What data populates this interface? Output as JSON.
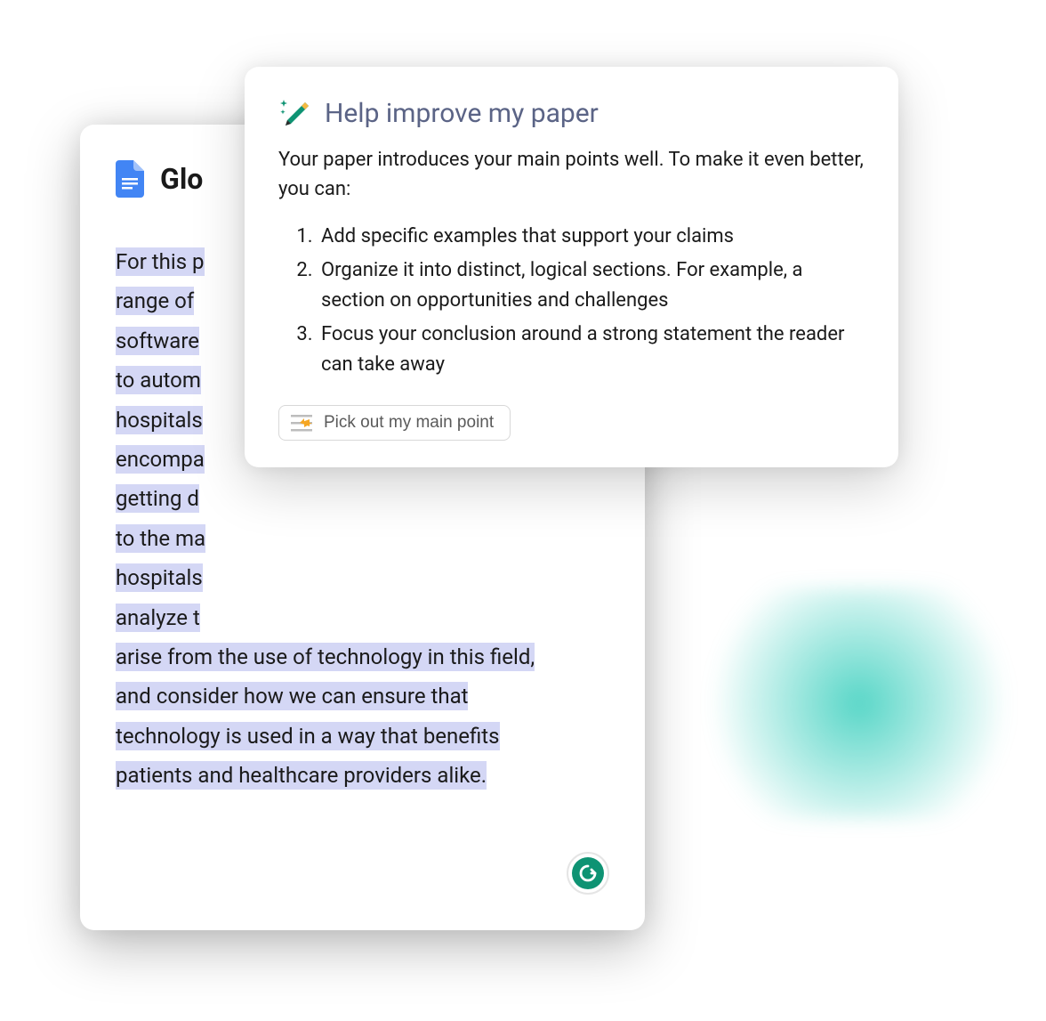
{
  "document": {
    "title_prefix": "Glo",
    "body_lines": [
      "For this p",
      "range of ",
      "software ",
      "to autom",
      "hospitals",
      "encompa",
      "getting d",
      "to the ma",
      "hospitals",
      "analyze t",
      "arise from the use of technology in this field,",
      "and consider how we can ensure that",
      "technology is used in a way that benefits",
      "patients and healthcare providers alike."
    ]
  },
  "panel": {
    "title": "Help improve my paper",
    "intro": "Your paper introduces your main points well. To make it even better, you can:",
    "items": [
      "Add specific examples that support your claims",
      "Organize it into distinct, logical sections. For example, a section on opportunities and challenges",
      "Focus your conclusion around a strong statement the reader can take away"
    ],
    "action_label": "Pick out my main point"
  }
}
